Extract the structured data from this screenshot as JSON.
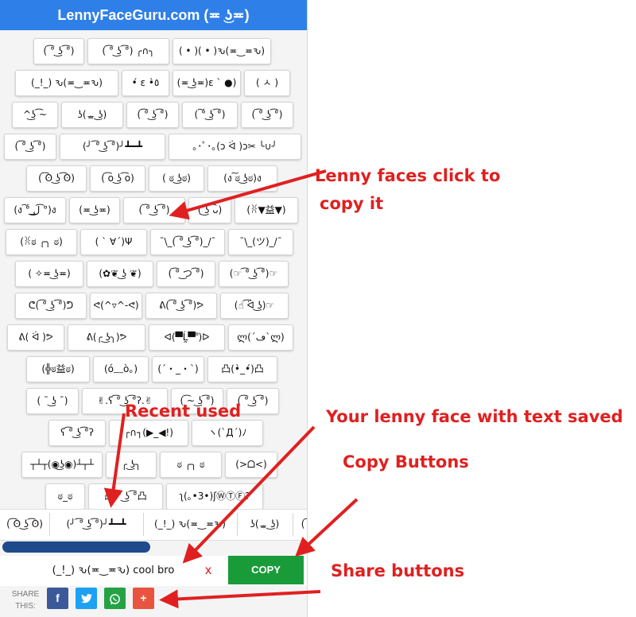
{
  "header": {
    "title": "LennyFaceGuru.com (≖ ͜ʖ≖)"
  },
  "faces": [
    [
      "( ͡° ͜ʖ ͡°)",
      "( ͡° ͜ʖ ͡°) ╭∩╮",
      "( • )( • )ԅ(≖‿≖ԅ)"
    ],
    [
      "(_!_) ԅ(≖‿≖ԅ)",
      "•́ ε •̀٥",
      "(≖ ͜ʖ≖)ε ` ●)",
      "( ㅅ )"
    ],
    [
      "^͜ʖ ͡~",
      "ʖ(ᇂ ͜ʖ)",
      "( ͡° ͜ʖ ͡°)",
      "( ͠° ͜ʖ ͡°)",
      "( ͡° ͜ʖ ͡°)"
    ],
    [
      "( ͡° ͜ʖ ͡°)",
      "(╯ ͡° ͜ʖ ͡°)╯┻━┻",
      "｡･ﾟ･｡(ɔ ᐛ )ɔ✂ ╰∪╯"
    ],
    [
      "( ͡ʘ ͜ʖ ͡ʘ)",
      "( ͡o ͜ʖ ͡o)",
      "( ಠ ͜ʖಠ)",
      "(ง ͠ಠ ͜ʖಠ)ง"
    ],
    [
      "(ง ͠° ͟ل͜ ͡°)ง",
      "(≖ ͜ʖ≖)",
      "( ͡° ͜ʖ ͡°)",
      "( ͜ʖ ͡ᴗ)",
      "(ꐦ▼益▼)"
    ],
    [
      "(ꐦಠ ╭╮ ಠ)",
      "( ` ∀´)Ψ",
      "¯\\_( ͡° ͜ʖ ͡°)_/¯",
      "¯\\_(ツ)_/¯"
    ],
    [
      "( ✧≖ ͜ʖ≖)",
      "(✿❦ ͜ʖ ❦)",
      "( ͡° ͜つ ͡°)",
      "(☞ ͡° ͜ʖ ͡°)☞"
    ],
    [
      "ᕦ( ͡° ͜ʖ ͡°)ᕤ",
      "ᕙ(^▿^-ᕙ)",
      "ᕕ( ͡° ͜ʖ ͡°)ᕗ",
      "(☝ ͡ᐛ ͜ʖ)☞"
    ],
    [
      "ᕕ( ᐛ )ᕗ",
      "ᕕ(╭ ͜ʖ╮)ᕗ",
      "ᐊ(▀̿Ĺ̯▀̿ ̿)ᐅ",
      "ლ(´ڡ`ლ)"
    ],
    [
      "(╬ಠ益ಠ)",
      "(ó﹏ò｡)",
      "(´・_・`)",
      "凸(•̀_•́)凸"
    ],
    [
      "( ¯ ͜ʖ ¯)",
      "✌.ʕ ͡° ͜ʖ ͡°ʔ.✌",
      "( ͡~ ͜ʖ ͡°)",
      "( ͡° ͜ʖ ͡°)"
    ],
    [
      "ʕ ͡° ͜ʖ ͡°ʔ",
      "┌∩┐(▶_◀!)",
      "ヽ(`Д´)ﾉ"
    ],
    [
      "┬┴┬(◉͜ʖ◉)┴┬┴",
      "╭ ͜ʖ╮",
      "ಠ ╭╮ ಠ",
      "(>ᗝ<)"
    ],
    [
      "ಠ_ಠ",
      "凸 ͡° ͜ʖ ͡°凸",
      "ʅ(｡•3•)ʃⓌⓉⒻ?"
    ]
  ],
  "recent": {
    "label": "Recent used",
    "items": [
      "( ͡ʘ ͜ʖ ͡ʘ)",
      "(╯ ͡° ͜ʖ ͡°)╯┻━┻",
      "(_!_) ԅ(≖‿≖ԅ)",
      "ʖ(ᇂ ͜ʖ)",
      "( ͡"
    ]
  },
  "output": {
    "value": "(_!_) ԅ(≖‿≖ԅ) cool bro",
    "clear": "x",
    "copy_label": "COPY"
  },
  "share": {
    "label": "SHARE THIS:",
    "buttons": [
      {
        "name": "facebook",
        "glyph": "f",
        "color": "#3b5998"
      },
      {
        "name": "twitter",
        "glyph": "t",
        "color": "#1da1f2"
      },
      {
        "name": "whatsapp",
        "glyph": "w",
        "color": "#25a244"
      },
      {
        "name": "more",
        "glyph": "+",
        "color": "#e9543f"
      }
    ]
  },
  "annotations": {
    "faces_note_1": "Lenny faces click to",
    "faces_note_2": "copy it",
    "saved_note": "Your lenny face with text saved",
    "copy_note": "Copy Buttons",
    "share_note": "Share buttons"
  },
  "colors": {
    "header": "#2f7fe8",
    "copy": "#1a9b3a",
    "annotation": "#e02020",
    "scrollbar": "#1f4a8c"
  }
}
